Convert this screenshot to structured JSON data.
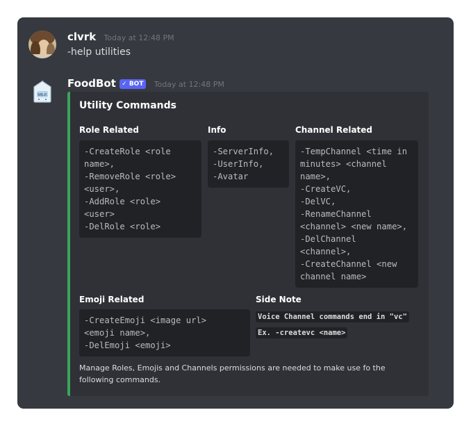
{
  "messages": [
    {
      "username": "clvrk",
      "timestamp": "Today at 12:48 PM",
      "text": "-help utilities"
    },
    {
      "username": "FoodBot",
      "bot_tag": "✓ BOT",
      "timestamp": "Today at 12:48 PM"
    }
  ],
  "embed": {
    "accent_color": "#3ba55d",
    "title": "Utility Commands",
    "fields": [
      {
        "name": "Role Related",
        "code": "-CreateRole <role\nname>,\n-RemoveRole <role>\n<user>,\n-AddRole <role>\n<user>\n-DelRole <role>"
      },
      {
        "name": "Info",
        "code": "-ServerInfo,\n-UserInfo,\n-Avatar"
      },
      {
        "name": "Channel Related",
        "code": "-TempChannel <time in\nminutes> <channel\nname>,\n-CreateVC,\n-DelVC,\n-RenameChannel\n<channel> <new name>,\n-DelChannel\n<channel>,\n-CreateChannel <new\nchannel name>"
      },
      {
        "name": "Emoji Related",
        "code": "-CreateEmoji <image url>\n<emoji name>,\n-DelEmoji <emoji>"
      },
      {
        "name": "Side Note",
        "line1": "Voice Channel commands end in \"vc\"",
        "line2": "Ex. -createvc <name>"
      }
    ],
    "footer": "Manage Roles, Emojis and Channels permissions are needed to make use fo the following commands."
  },
  "colors": {
    "background": "#36393f",
    "embed_background": "#2f3136",
    "code_background": "#202225",
    "bot_tag": "#5865f2"
  }
}
